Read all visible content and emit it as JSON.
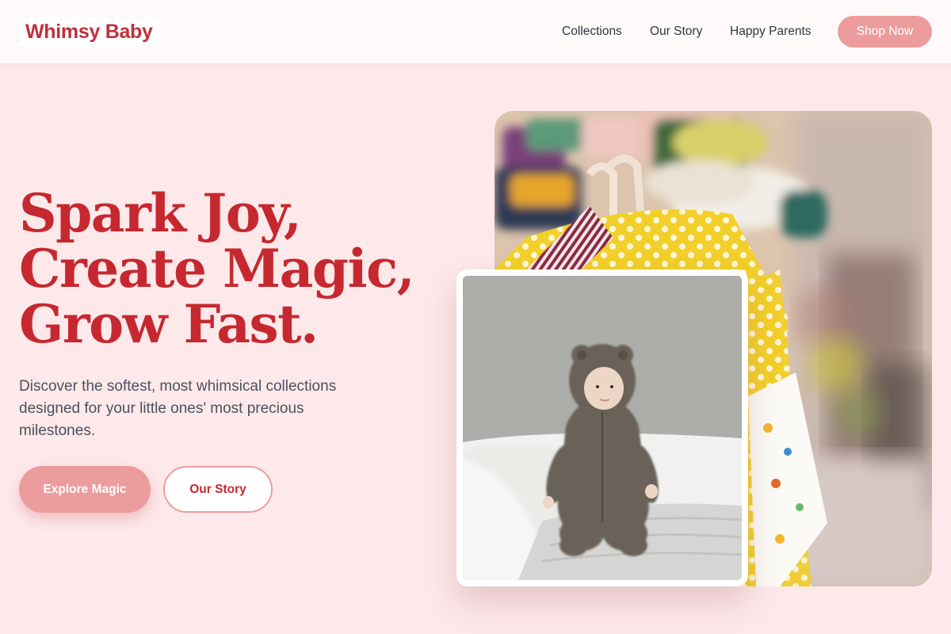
{
  "brand": {
    "name": "Whimsy Baby"
  },
  "nav": {
    "links": [
      "Collections",
      "Our Story",
      "Happy Parents"
    ],
    "cta": "Shop Now"
  },
  "hero": {
    "headline": [
      "Spark Joy,",
      "Create Magic,",
      "Grow Fast."
    ],
    "subtitle": "Discover the softest, most whimsical collections designed for your little ones' most precious milestones.",
    "primary_button": "Explore Magic",
    "secondary_button": "Our Story"
  },
  "images": {
    "main": "clothing-rack-photo",
    "card": "baby-in-bear-suit-photo"
  },
  "colors": {
    "page_bg": "#fde8ea",
    "brand_red": "#c6282f",
    "accent_pink": "#ec9c9c",
    "text_dark": "#2f3640"
  }
}
